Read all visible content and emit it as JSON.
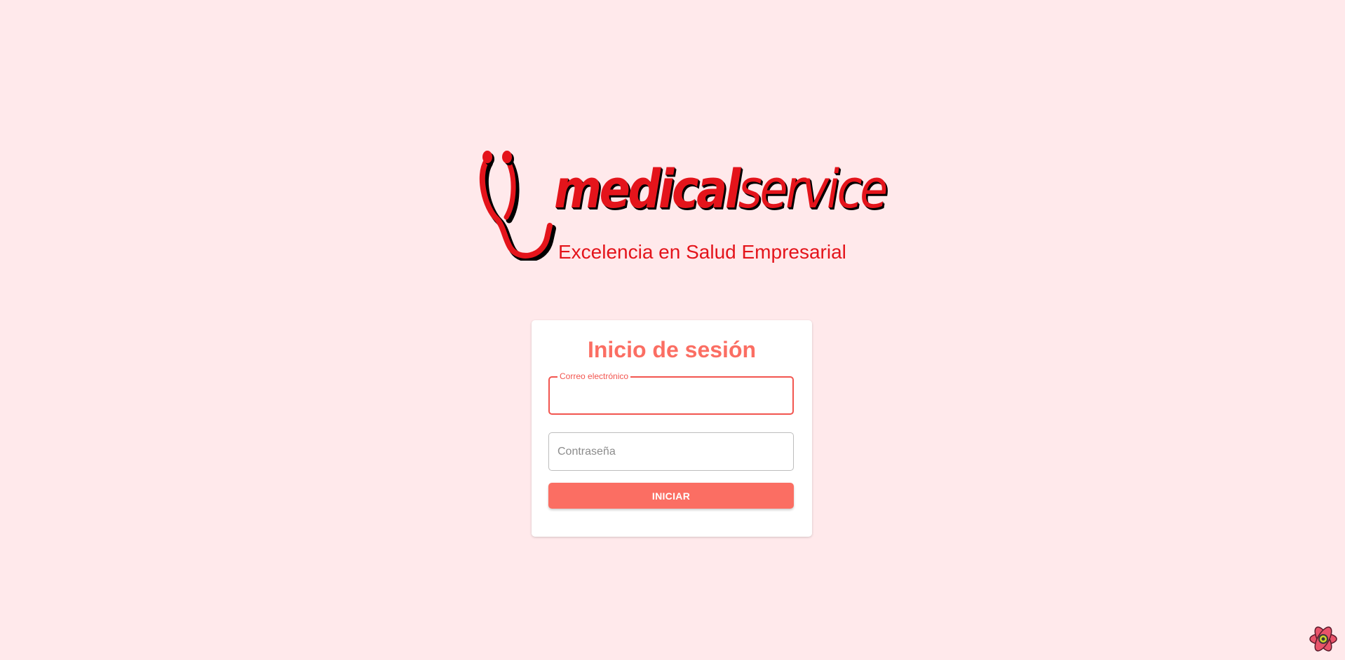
{
  "logo": {
    "word_part1": "medical",
    "word_part2": "service",
    "tagline": "Excelencia en Salud Empresarial",
    "brand_color": "#e4141b"
  },
  "login": {
    "title": "Inicio de sesión",
    "email_label": "Correo electrónico",
    "email_value": "",
    "password_placeholder": "Contraseña",
    "password_value": "",
    "submit_label": "INICIAR",
    "accent_color": "#fb6e63"
  },
  "corner_icon": "atom-icon"
}
